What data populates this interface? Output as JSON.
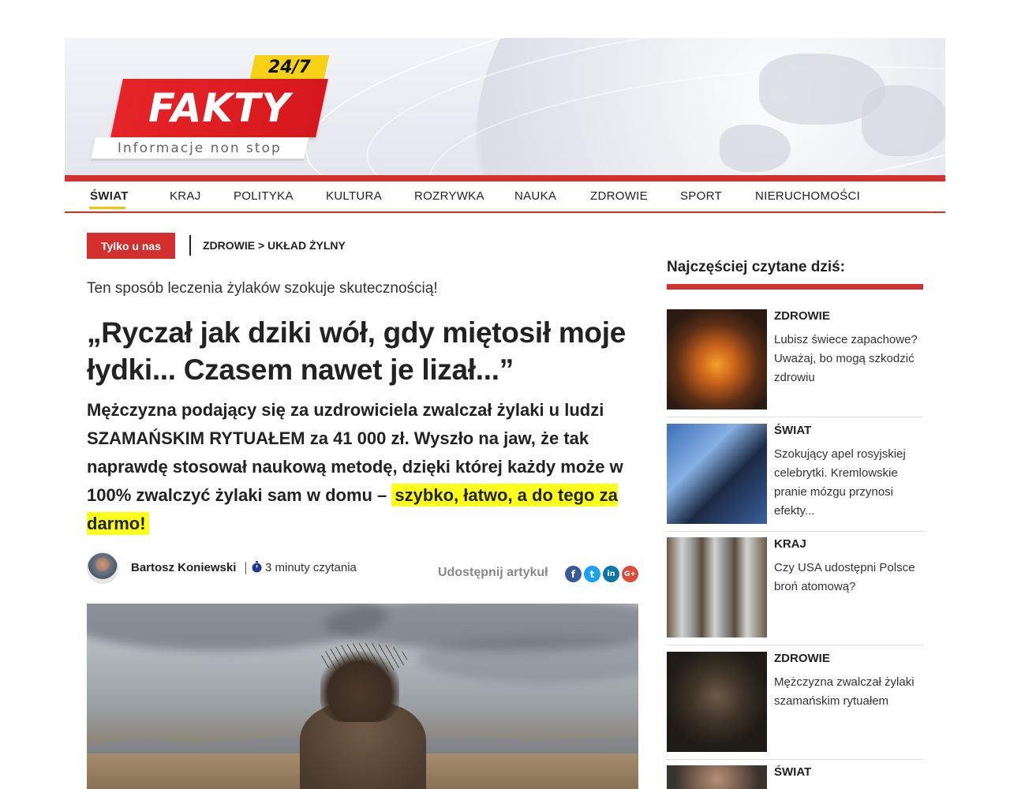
{
  "logo": {
    "badge": "24/7",
    "name": "FAKTY",
    "tagline": "Informacje non stop"
  },
  "nav": {
    "items": [
      {
        "label": "ŚWIAT",
        "active": true
      },
      {
        "label": "KRAJ"
      },
      {
        "label": "POLITYKA"
      },
      {
        "label": "KULTURA"
      },
      {
        "label": "ROZRYWKA"
      },
      {
        "label": "NAUKA"
      },
      {
        "label": "ZDROWIE"
      },
      {
        "label": "SPORT"
      },
      {
        "label": "NIERUCHOMOŚCI"
      }
    ]
  },
  "article": {
    "tag": "Tylko u nas",
    "breadcrumb": "ZDROWIE > UKŁAD ŻYLNY",
    "subtitle": "Ten sposób leczenia żylaków szokuje skutecznością!",
    "headline": "„Ryczał jak dziki wół, gdy miętosił moje łydki... Czasem nawet je lizał...”",
    "lead": "Mężczyzna podający się za uzdrowiciela zwalczał żylaki u ludzi SZAMAŃSKIM RYTUAŁEM za 41 000 zł. Wyszło na jaw, że tak naprawdę stosował naukową metodę, dzięki której każdy może w 100% zwalczyć żylaki sam w domu –",
    "lead_highlight": "szybko, łatwo, a do tego za darmo!",
    "author": "Bartosz Koniewski",
    "read_time": "3 minuty czytania",
    "share_label": "Udostępnij artykuł",
    "share_icons": [
      {
        "name": "facebook-icon",
        "glyph": "f",
        "color": "#3b5998"
      },
      {
        "name": "twitter-icon",
        "glyph": "t",
        "color": "#1da1f2"
      },
      {
        "name": "linkedin-icon",
        "glyph": "in",
        "color": "#0e76a8"
      },
      {
        "name": "google-plus-icon",
        "glyph": "G+",
        "color": "#dd4b39"
      }
    ]
  },
  "sidebar": {
    "title": "Najczęściej czytane dziś:",
    "items": [
      {
        "category": "ZDROWIE",
        "text": "Lubisz świece zapachowe? Uważaj, bo mogą szkodzić zdrowiu"
      },
      {
        "category": "ŚWIAT",
        "text": "Szokujący apel rosyjskiej celebrytki. Kremlowskie pranie mózgu przynosi efekty..."
      },
      {
        "category": "KRAJ",
        "text": "Czy USA udostępni Polsce broń atomową?"
      },
      {
        "category": "ZDROWIE",
        "text": "Mężczyzna zwalczał żylaki szamańskim rytuałem"
      },
      {
        "category": "ŚWIAT",
        "text": ""
      }
    ]
  },
  "colors": {
    "accent": "#d32f2f",
    "highlight": "#fbff1a",
    "nav_active_underline": "#f7c400"
  }
}
